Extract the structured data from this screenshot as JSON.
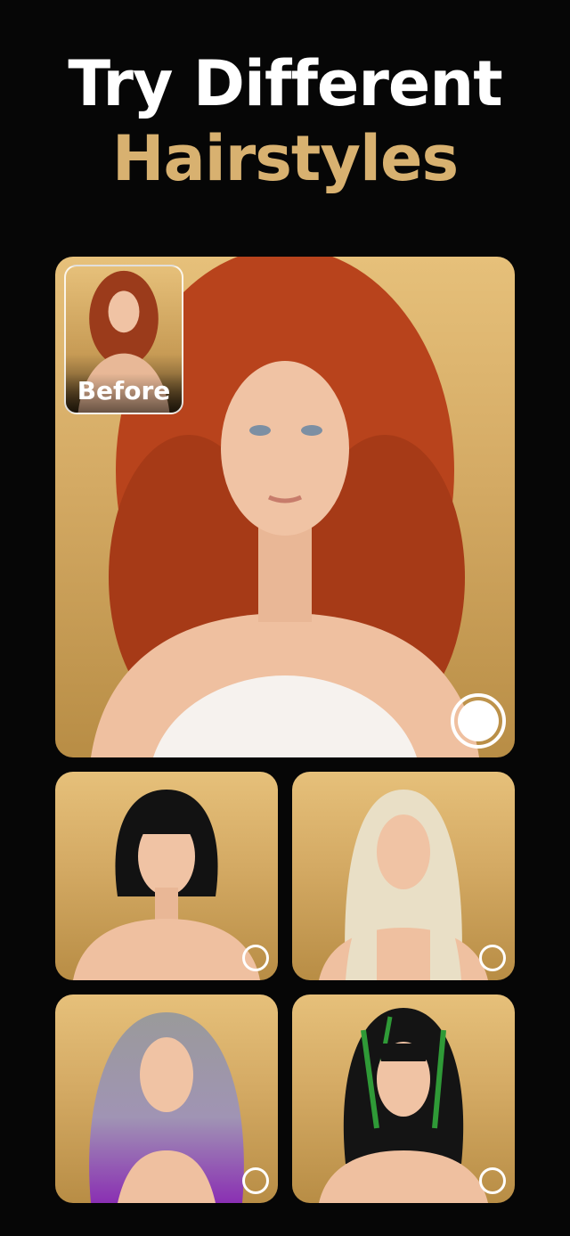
{
  "headline": {
    "line1": "Try Different",
    "line2": "Hairstyles"
  },
  "before_thumbnail": {
    "label": "Before"
  },
  "main_preview": {
    "selected": true
  },
  "styles": [
    {
      "hair_color": "#b8431c",
      "selected": true
    },
    {
      "hair_color": "#121212",
      "selected": false
    },
    {
      "hair_color": "#e9dfc6",
      "selected": false
    },
    {
      "hair_color": "#9a9a9a",
      "accent_color": "#8a2fb3",
      "selected": false
    },
    {
      "hair_color": "#141414",
      "accent_color": "#2f9a37",
      "selected": false
    }
  ],
  "colors": {
    "background": "#060606",
    "accent_gold": "#d8b170",
    "card_gold": "#d4aa64"
  }
}
